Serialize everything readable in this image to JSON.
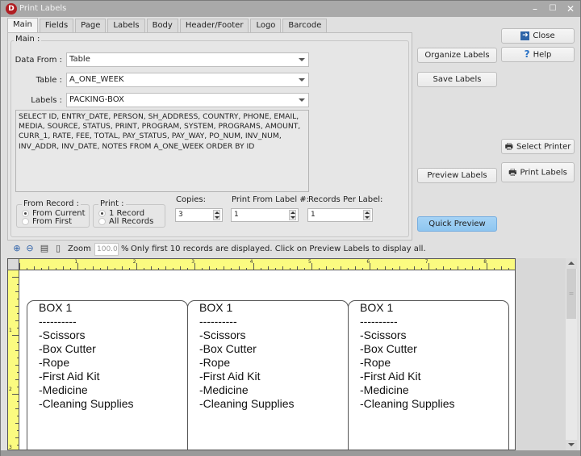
{
  "window": {
    "title": "Print Labels",
    "app_icon_letter": "D",
    "controls": {
      "minimize": "–",
      "maximize": "☐",
      "close": "✕"
    }
  },
  "tabs": [
    {
      "label": "Main",
      "active": true
    },
    {
      "label": "Fields",
      "active": false
    },
    {
      "label": "Page",
      "active": false
    },
    {
      "label": "Labels",
      "active": false
    },
    {
      "label": "Body",
      "active": false
    },
    {
      "label": "Header/Footer",
      "active": false
    },
    {
      "label": "Logo",
      "active": false
    },
    {
      "label": "Barcode",
      "active": false
    }
  ],
  "main": {
    "group_label": "Main :",
    "data_from": {
      "label": "Data From :",
      "value": "Table"
    },
    "table": {
      "label": "Table :",
      "value": "A_ONE_WEEK"
    },
    "labels": {
      "label": "Labels :",
      "value": "PACKING-BOX"
    },
    "sql_lines": [
      "SELECT ID, ENTRY_DATE, PERSON, SH_ADDRESS, COUNTRY, PHONE, EMAIL,",
      "MEDIA, SOURCE, STATUS, PRINT, PROGRAM, SYSTEM, PROGRAMS, AMOUNT,",
      "CURR_1, RATE, FEE, TOTAL, PAY_STATUS, PAY_WAY, PO_NUM, INV_NUM,",
      "INV_ADDR, INV_DATE, NOTES  FROM A_ONE_WEEK ORDER BY ID"
    ],
    "from_record": {
      "label": "From Record :",
      "options": [
        {
          "label": "From Current",
          "selected": true
        },
        {
          "label": "From First",
          "selected": false
        }
      ]
    },
    "print": {
      "label": "Print :",
      "options": [
        {
          "label": "1 Record",
          "selected": true
        },
        {
          "label": "All Records",
          "selected": false
        }
      ]
    },
    "copies": {
      "label": "Copies:",
      "value": "3"
    },
    "print_from_label": {
      "label": "Print From Label #:",
      "value": "1"
    },
    "records_per_label": {
      "label": "Records Per Label:",
      "value": "1"
    }
  },
  "buttons": {
    "close": "Close",
    "help": "Help",
    "organize_labels": "Organize Labels",
    "save_labels": "Save Labels",
    "select_printer": "Select Printer",
    "preview_labels": "Preview Labels",
    "print_labels": "Print Labels",
    "quick_preview": "Quick Preview"
  },
  "toolbar": {
    "zoom_label": "Zoom",
    "zoom_value": "100.0",
    "percent": "%",
    "message": "Only first 10 records are displayed. Click on Preview Labels to display all.",
    "icons": [
      "zoom-in-icon",
      "zoom-out-icon",
      "fit-width-icon",
      "fit-page-icon"
    ]
  },
  "ruler": {
    "top_numbers": [
      "1",
      "2",
      "3",
      "4",
      "5",
      "6",
      "7",
      "8"
    ],
    "left_numbers": [
      "1",
      "2",
      "3"
    ]
  },
  "labels_preview": [
    {
      "lines": [
        "BOX 1",
        "----------",
        "-Scissors",
        "-Box Cutter",
        "-Rope",
        "-First Aid Kit",
        "-Medicine",
        "-Cleaning Supplies"
      ]
    },
    {
      "lines": [
        "BOX 1",
        "----------",
        "-Scissors",
        "-Box Cutter",
        "-Rope",
        "-First Aid Kit",
        "-Medicine",
        "-Cleaning Supplies"
      ]
    },
    {
      "lines": [
        "BOX 1",
        "----------",
        "-Scissors",
        "-Box Cutter",
        "-Rope",
        "-First Aid Kit",
        "-Medicine",
        "-Cleaning Supplies"
      ]
    }
  ],
  "colors": {
    "ruler": "#fbfb80",
    "primary_button": "#8ec6f0",
    "app_icon": "#b01e23"
  }
}
